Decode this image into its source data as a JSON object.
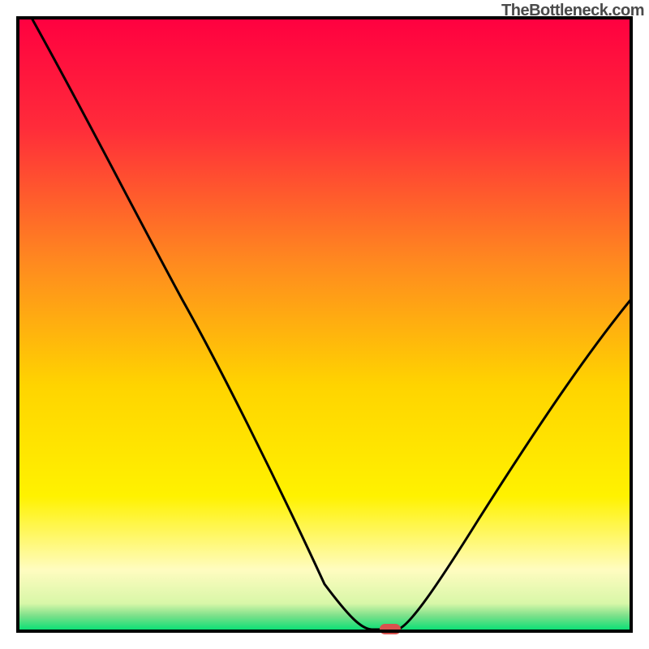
{
  "attribution": "TheBottleneck.com",
  "chart_data": {
    "type": "line",
    "title": "",
    "xlabel": "",
    "ylabel": "",
    "xlim": [
      0,
      100
    ],
    "ylim": [
      0,
      100
    ],
    "series": [
      {
        "name": "bottleneck-curve",
        "x": [
          3,
          10,
          20,
          30,
          40,
          50,
          55,
          58,
          60,
          62,
          65,
          70,
          80,
          90,
          100
        ],
        "y": [
          100,
          87,
          68,
          52,
          36,
          18,
          8,
          2,
          0,
          0,
          2,
          10,
          25,
          40,
          55
        ]
      }
    ],
    "optimal_region": {
      "x_start": 58,
      "x_end": 62,
      "y": 0
    },
    "gradient_stops": [
      {
        "pos": 0.0,
        "color": "#ff0040"
      },
      {
        "pos": 0.18,
        "color": "#ff2c3a"
      },
      {
        "pos": 0.4,
        "color": "#ff8a1f"
      },
      {
        "pos": 0.6,
        "color": "#ffd400"
      },
      {
        "pos": 0.78,
        "color": "#fff200"
      },
      {
        "pos": 0.9,
        "color": "#fffcc0"
      },
      {
        "pos": 0.955,
        "color": "#d8f7a8"
      },
      {
        "pos": 0.975,
        "color": "#7be08a"
      },
      {
        "pos": 1.0,
        "color": "#00e074"
      }
    ],
    "marker": {
      "color": "#d8524e",
      "x": 60,
      "y": 0,
      "rx": 10,
      "ry": 6
    }
  }
}
